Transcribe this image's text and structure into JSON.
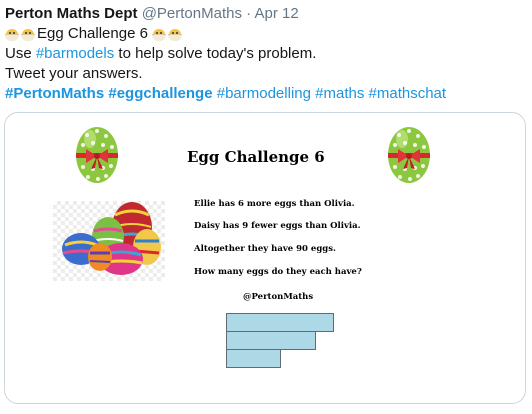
{
  "tweet": {
    "author_name": "Perton Maths Dept",
    "handle": "@PertonMaths",
    "separator": "·",
    "date": "Apr 12",
    "line1_text": "Egg Challenge 6",
    "line2_prefix": "Use ",
    "line2_link": "#barmodels",
    "line2_suffix": " to help solve today's problem.",
    "line3": "Tweet your answers.",
    "hashtags": [
      "#PertonMaths",
      "#eggchallenge",
      "#barmodelling",
      "#maths",
      "#mathschat"
    ]
  },
  "image": {
    "title": "Egg Challenge 6",
    "lines": [
      "Ellie has 6 more eggs than Olivia.",
      "Daisy has 9 fewer eggs than Olivia.",
      "Altogether they have 90 eggs.",
      "How many eggs do they each have?"
    ],
    "credit": "@PertonMaths"
  },
  "colors": {
    "link": "#1b95e0",
    "egg_green": "#8dc63f",
    "ribbon_red": "#d9282f",
    "bar_fill": "#add8e6"
  },
  "icons": [
    "hatching-chick-icon",
    "egg-icon"
  ]
}
